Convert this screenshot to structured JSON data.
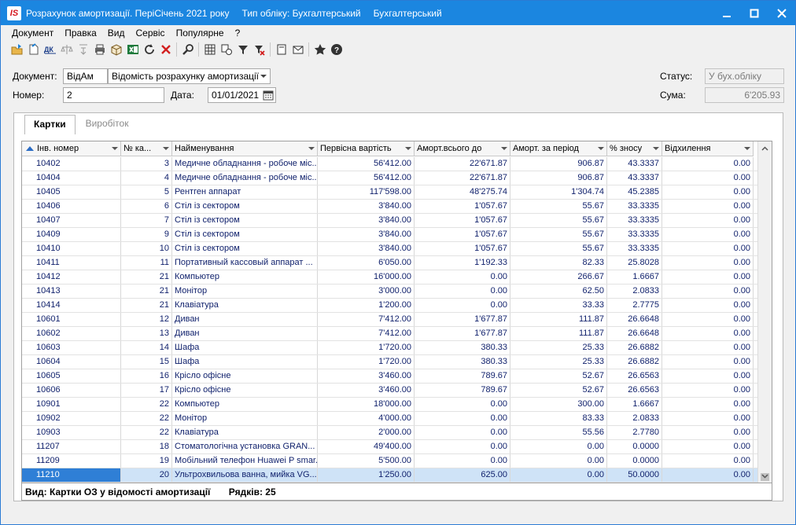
{
  "window": {
    "logo": "IS",
    "title_parts": [
      "Розрахунок амортизації. ПеріСічень 2021 року",
      "Тип обліку: Бухгалтерський",
      "Бухгалтерський"
    ]
  },
  "menu": [
    "Документ",
    "Правка",
    "Вид",
    "Сервіс",
    "Популярне",
    "?"
  ],
  "form": {
    "document_label": "Документ:",
    "document_code": "ВідАм",
    "document_name": "Відомість розрахунку амортизації",
    "number_label": "Номер:",
    "number_value": "2",
    "date_label": "Дата:",
    "date_value": "01/01/2021",
    "status_label": "Статус:",
    "status_value": "У бух.обліку",
    "sum_label": "Сума:",
    "sum_value": "6'205.93"
  },
  "tabs": [
    "Картки",
    "Виробіток"
  ],
  "grid": {
    "columns": [
      "Інв. номер",
      "№ ка...",
      "Найменування",
      "Первісна вартість",
      "Аморт.всього до",
      "Аморт. за період",
      "% зносу",
      "Відхилення"
    ],
    "rows": [
      [
        "10402",
        "3",
        "Медичне обладнання - робоче міс...",
        "56'412.00",
        "22'671.87",
        "906.87",
        "43.3337",
        "0.00"
      ],
      [
        "10404",
        "4",
        "Медичне обладнання - робоче міс...",
        "56'412.00",
        "22'671.87",
        "906.87",
        "43.3337",
        "0.00"
      ],
      [
        "10405",
        "5",
        "Рентген аппарат",
        "117'598.00",
        "48'275.74",
        "1'304.74",
        "45.2385",
        "0.00"
      ],
      [
        "10406",
        "6",
        "Стіл із сектором",
        "3'840.00",
        "1'057.67",
        "55.67",
        "33.3335",
        "0.00"
      ],
      [
        "10407",
        "7",
        "Стіл із сектором",
        "3'840.00",
        "1'057.67",
        "55.67",
        "33.3335",
        "0.00"
      ],
      [
        "10409",
        "9",
        "Стіл із сектором",
        "3'840.00",
        "1'057.67",
        "55.67",
        "33.3335",
        "0.00"
      ],
      [
        "10410",
        "10",
        "Стіл із сектором",
        "3'840.00",
        "1'057.67",
        "55.67",
        "33.3335",
        "0.00"
      ],
      [
        "10411",
        "11",
        "Портативный кассовый аппарат ...",
        "6'050.00",
        "1'192.33",
        "82.33",
        "25.8028",
        "0.00"
      ],
      [
        "10412",
        "21",
        "Компьютер",
        "16'000.00",
        "0.00",
        "266.67",
        "1.6667",
        "0.00"
      ],
      [
        "10413",
        "21",
        "Монітор",
        "3'000.00",
        "0.00",
        "62.50",
        "2.0833",
        "0.00"
      ],
      [
        "10414",
        "21",
        "Клавіатура",
        "1'200.00",
        "0.00",
        "33.33",
        "2.7775",
        "0.00"
      ],
      [
        "10601",
        "12",
        "Диван",
        "7'412.00",
        "1'677.87",
        "111.87",
        "26.6648",
        "0.00"
      ],
      [
        "10602",
        "13",
        "Диван",
        "7'412.00",
        "1'677.87",
        "111.87",
        "26.6648",
        "0.00"
      ],
      [
        "10603",
        "14",
        "Шафа",
        "1'720.00",
        "380.33",
        "25.33",
        "26.6882",
        "0.00"
      ],
      [
        "10604",
        "15",
        "Шафа",
        "1'720.00",
        "380.33",
        "25.33",
        "26.6882",
        "0.00"
      ],
      [
        "10605",
        "16",
        "Крісло офісне",
        "3'460.00",
        "789.67",
        "52.67",
        "26.6563",
        "0.00"
      ],
      [
        "10606",
        "17",
        "Крісло офісне",
        "3'460.00",
        "789.67",
        "52.67",
        "26.6563",
        "0.00"
      ],
      [
        "10901",
        "22",
        "Компьютер",
        "18'000.00",
        "0.00",
        "300.00",
        "1.6667",
        "0.00"
      ],
      [
        "10902",
        "22",
        "Монітор",
        "4'000.00",
        "0.00",
        "83.33",
        "2.0833",
        "0.00"
      ],
      [
        "10903",
        "22",
        "Клавіатура",
        "2'000.00",
        "0.00",
        "55.56",
        "2.7780",
        "0.00"
      ],
      [
        "11207",
        "18",
        "Стоматологічна установка GRAN...",
        "49'400.00",
        "0.00",
        "0.00",
        "0.0000",
        "0.00"
      ],
      [
        "11209",
        "19",
        "Мобільний телефон Huawei P smar...",
        "5'500.00",
        "0.00",
        "0.00",
        "0.0000",
        "0.00"
      ],
      [
        "11210",
        "20",
        "Ультрохвильова ванна, мийка VG...",
        "1'250.00",
        "625.00",
        "0.00",
        "50.0000",
        "0.00"
      ]
    ],
    "selected_row": 22
  },
  "footer": {
    "view_text": "Вид: Картки ОЗ у відомості амортизації",
    "rows_text": "Рядків: 25"
  }
}
